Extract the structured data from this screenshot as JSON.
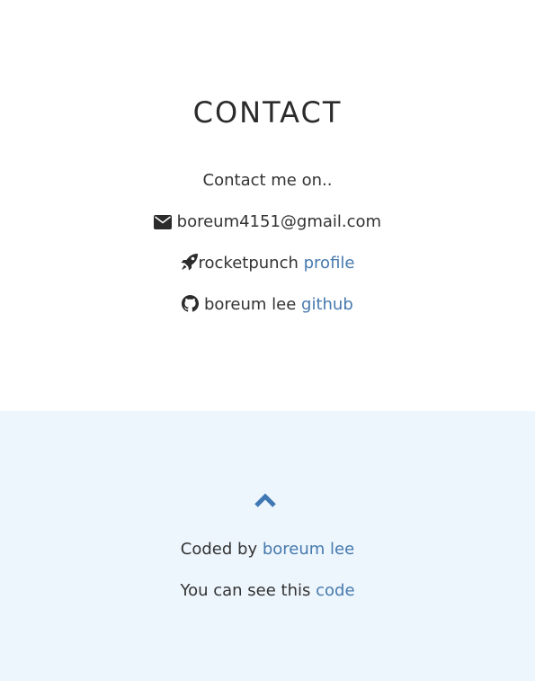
{
  "contact": {
    "title": "CONTACT",
    "intro": "Contact me on..",
    "email": {
      "icon": "envelope-icon",
      "address": "boreum4151@gmail.com"
    },
    "rocketpunch": {
      "icon": "rocket-icon",
      "text": "rocketpunch",
      "link_label": "profile"
    },
    "github": {
      "icon": "github-icon",
      "text": "boreum lee",
      "link_label": "github"
    }
  },
  "footer": {
    "up_icon": "chevron-up-icon",
    "coded_prefix": "Coded by",
    "coded_link": "boreum lee",
    "code_prefix": "You can see this",
    "code_link": "code"
  },
  "colors": {
    "link": "#4679ad",
    "footer_background": "#eef6fd",
    "text": "#2b2b2b"
  }
}
